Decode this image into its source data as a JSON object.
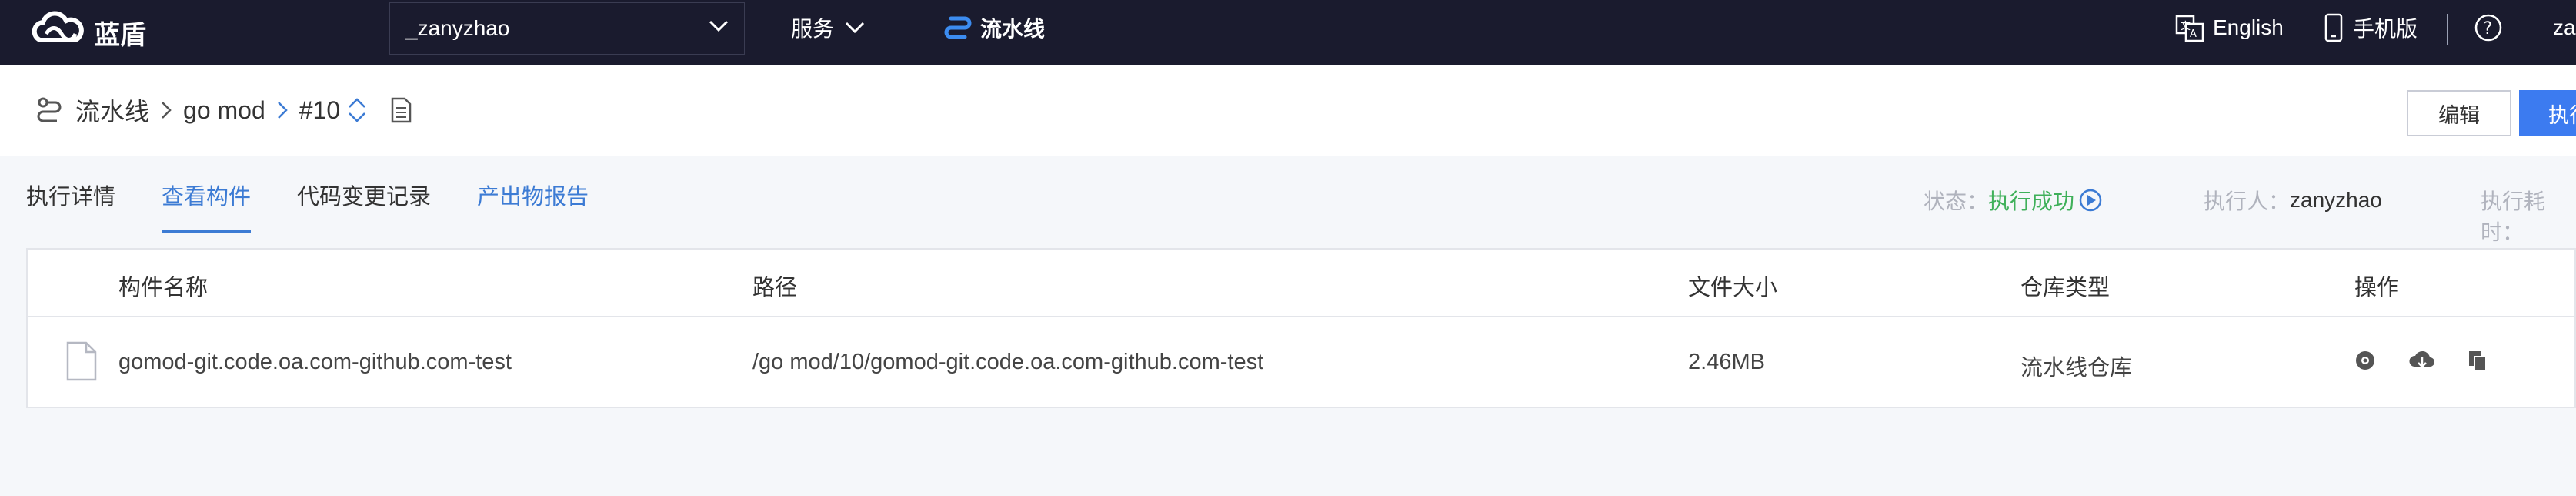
{
  "brand": {
    "name": "蓝盾"
  },
  "topbar": {
    "project": "_zanyzhao",
    "service_label": "服务",
    "pipeline_label": "流水线",
    "lang_label": "English",
    "mobile_label": "手机版",
    "user_label": "za"
  },
  "breadcrumb": {
    "root": "流水线",
    "pipeline": "go mod",
    "build": "#10"
  },
  "actions": {
    "edit": "编辑",
    "execute": "执行"
  },
  "tabs": [
    {
      "label": "执行详情"
    },
    {
      "label": "查看构件"
    },
    {
      "label": "代码变更记录"
    },
    {
      "label": "产出物报告"
    }
  ],
  "status": {
    "state_label": "状态：",
    "state_value": "执行成功",
    "executor_label": "执行人：",
    "executor_value": "zanyzhao",
    "duration_label": "执行耗时："
  },
  "table": {
    "columns": [
      "构件名称",
      "路径",
      "文件大小",
      "仓库类型",
      "操作"
    ],
    "rows": [
      {
        "name": "gomod-git.code.oa.com-github.com-test",
        "path": "/go mod/10/gomod-git.code.oa.com-github.com-test",
        "size": "2.46MB",
        "repo": "流水线仓库"
      }
    ]
  },
  "colors": {
    "topbar": "#1a1b2e",
    "accent": "#3c7bd4",
    "success": "#3fb05a",
    "primary_button": "#3c7bf0"
  }
}
